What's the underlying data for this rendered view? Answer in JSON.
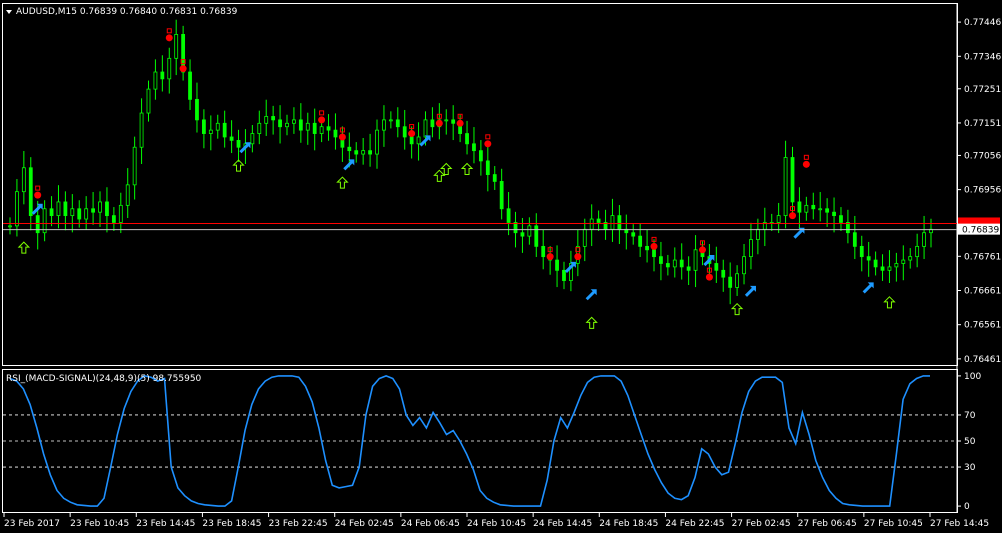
{
  "chart_data": [
    {
      "type": "candlestick",
      "symbol_header": "AUDUSD,M15  0.76839 0.76840 0.76831 0.76839",
      "y_ticks": [
        "0.77446",
        "0.77346",
        "0.77251",
        "0.77151",
        "0.77056",
        "0.76956",
        "0.76761",
        "0.76661",
        "0.76561",
        "0.76461"
      ],
      "ylim": [
        0.76446,
        0.77496
      ],
      "current_price_label": "0.76839",
      "current_price": 0.76839,
      "ask_price": 0.76857,
      "x_labels": [
        "23 Feb 2017",
        "23 Feb 10:45",
        "23 Feb 14:45",
        "23 Feb 18:45",
        "23 Feb 22:45",
        "24 Feb 02:45",
        "24 Feb 06:45",
        "24 Feb 10:45",
        "24 Feb 14:45",
        "24 Feb 18:45",
        "24 Feb 22:45",
        "27 Feb 02:45",
        "27 Feb 06:45",
        "27 Feb 10:45",
        "27 Feb 14:45"
      ],
      "close_series": [
        0.7685,
        0.7695,
        0.7702,
        0.7688,
        0.7683,
        0.769,
        0.7688,
        0.7692,
        0.7688,
        0.769,
        0.7687,
        0.769,
        0.7689,
        0.7692,
        0.7688,
        0.7686,
        0.7691,
        0.7697,
        0.7708,
        0.7718,
        0.7725,
        0.773,
        0.7728,
        0.7734,
        0.7741,
        0.773,
        0.7722,
        0.7716,
        0.7712,
        0.7713,
        0.7715,
        0.7711,
        0.771,
        0.7708,
        0.7709,
        0.7712,
        0.7715,
        0.7717,
        0.7716,
        0.7714,
        0.7715,
        0.7716,
        0.7713,
        0.7715,
        0.7712,
        0.7714,
        0.7713,
        0.7711,
        0.7708,
        0.7707,
        0.7706,
        0.7707,
        0.7706,
        0.7713,
        0.7716,
        0.7716,
        0.7714,
        0.7711,
        0.7709,
        0.7711,
        0.7716,
        0.7714,
        0.7716,
        0.7716,
        0.7715,
        0.7712,
        0.7709,
        0.7707,
        0.7704,
        0.77,
        0.7698,
        0.769,
        0.7686,
        0.7683,
        0.7682,
        0.7685,
        0.7679,
        0.7676,
        0.7675,
        0.7672,
        0.7669,
        0.7674,
        0.7679,
        0.7684,
        0.7687,
        0.7686,
        0.7684,
        0.7688,
        0.7684,
        0.7683,
        0.7682,
        0.7679,
        0.7678,
        0.7676,
        0.7674,
        0.7673,
        0.7675,
        0.7673,
        0.7672,
        0.7678,
        0.7676,
        0.7674,
        0.7672,
        0.767,
        0.7667,
        0.7671,
        0.7676,
        0.7681,
        0.7684,
        0.7686,
        0.7686,
        0.7688,
        0.7705,
        0.7692,
        0.7689,
        0.7691,
        0.769,
        0.769,
        0.7689,
        0.7688,
        0.7686,
        0.7683,
        0.7679,
        0.7676,
        0.7675,
        0.7673,
        0.7672,
        0.7673,
        0.7674,
        0.7675,
        0.7676,
        0.7679,
        0.7683,
        0.7684
      ],
      "up_arrows": [
        {
          "i": 2,
          "v": 0.7682
        },
        {
          "i": 33,
          "v": 0.7706
        },
        {
          "i": 48,
          "v": 0.7701
        },
        {
          "i": 62,
          "v": 0.7703
        },
        {
          "i": 63,
          "v": 0.7705
        },
        {
          "i": 66,
          "v": 0.7705
        },
        {
          "i": 84,
          "v": 0.766
        },
        {
          "i": 105,
          "v": 0.7664
        },
        {
          "i": 127,
          "v": 0.7666
        }
      ],
      "buy_arrows": [
        {
          "i": 4,
          "v": 0.769
        },
        {
          "i": 34,
          "v": 0.7708
        },
        {
          "i": 49,
          "v": 0.7703
        },
        {
          "i": 60,
          "v": 0.771
        },
        {
          "i": 81,
          "v": 0.7673
        },
        {
          "i": 84,
          "v": 0.7665
        },
        {
          "i": 101,
          "v": 0.7675
        },
        {
          "i": 107,
          "v": 0.7666
        },
        {
          "i": 114,
          "v": 0.7683
        },
        {
          "i": 124,
          "v": 0.7667
        }
      ],
      "down_markers": [
        {
          "i": 4,
          "v": 0.7694
        },
        {
          "i": 23,
          "v": 0.774
        },
        {
          "i": 25,
          "v": 0.7731
        },
        {
          "i": 45,
          "v": 0.7716
        },
        {
          "i": 48,
          "v": 0.7711
        },
        {
          "i": 58,
          "v": 0.7712
        },
        {
          "i": 62,
          "v": 0.7715
        },
        {
          "i": 65,
          "v": 0.7715
        },
        {
          "i": 69,
          "v": 0.7709
        },
        {
          "i": 78,
          "v": 0.7676
        },
        {
          "i": 82,
          "v": 0.7676
        },
        {
          "i": 93,
          "v": 0.7679
        },
        {
          "i": 100,
          "v": 0.7678
        },
        {
          "i": 101,
          "v": 0.767
        },
        {
          "i": 113,
          "v": 0.7688
        },
        {
          "i": 115,
          "v": 0.7703
        }
      ]
    },
    {
      "type": "line",
      "title": "RSI_(MACD-SIGNAL)(24,48,9)(5) 98.755950",
      "y_ticks": [
        "100",
        "70",
        "50",
        "30",
        "0"
      ],
      "ylim": [
        -3,
        103
      ],
      "levels": [
        70,
        50,
        30
      ],
      "series": [
        {
          "values": [
            98,
            96,
            90,
            78,
            60,
            40,
            24,
            12,
            6,
            3,
            1,
            0.5,
            0,
            0,
            6,
            30,
            55,
            75,
            88,
            96,
            100,
            99,
            96,
            98,
            30,
            14,
            8,
            4,
            2,
            1,
            0.5,
            0,
            0,
            4,
            30,
            58,
            78,
            90,
            96,
            99,
            100,
            100,
            100,
            99,
            92,
            80,
            60,
            35,
            16,
            14,
            15,
            16,
            30,
            70,
            92,
            98,
            100,
            98,
            90,
            70,
            62,
            68,
            60,
            72,
            64,
            55,
            58,
            50,
            40,
            28,
            12,
            6,
            3,
            1,
            0.5,
            0,
            0,
            0,
            0,
            0,
            20,
            50,
            68,
            60,
            72,
            85,
            95,
            99,
            100,
            100,
            100,
            96,
            85,
            70,
            55,
            40,
            28,
            18,
            10,
            6,
            5,
            8,
            22,
            44,
            40,
            30,
            24,
            26,
            48,
            72,
            88,
            96,
            99,
            99,
            99,
            95,
            60,
            48,
            72,
            55,
            35,
            22,
            12,
            6,
            2,
            1,
            0.5,
            0,
            0,
            0,
            0,
            0,
            40,
            82,
            94,
            98,
            100,
            100
          ]
        }
      ]
    }
  ],
  "colors": {
    "background": "#000000",
    "candle_up": "#00ff00",
    "candle_down": "#00ff00",
    "grid": "#ffffff",
    "rsi_line": "#1e90ff",
    "ask_line": "#ff0000",
    "bid_line": "#ffffff",
    "up_arrow": "#7fff00",
    "buy_arrow": "#1e9bff",
    "sell_marker": "#ff0000"
  }
}
